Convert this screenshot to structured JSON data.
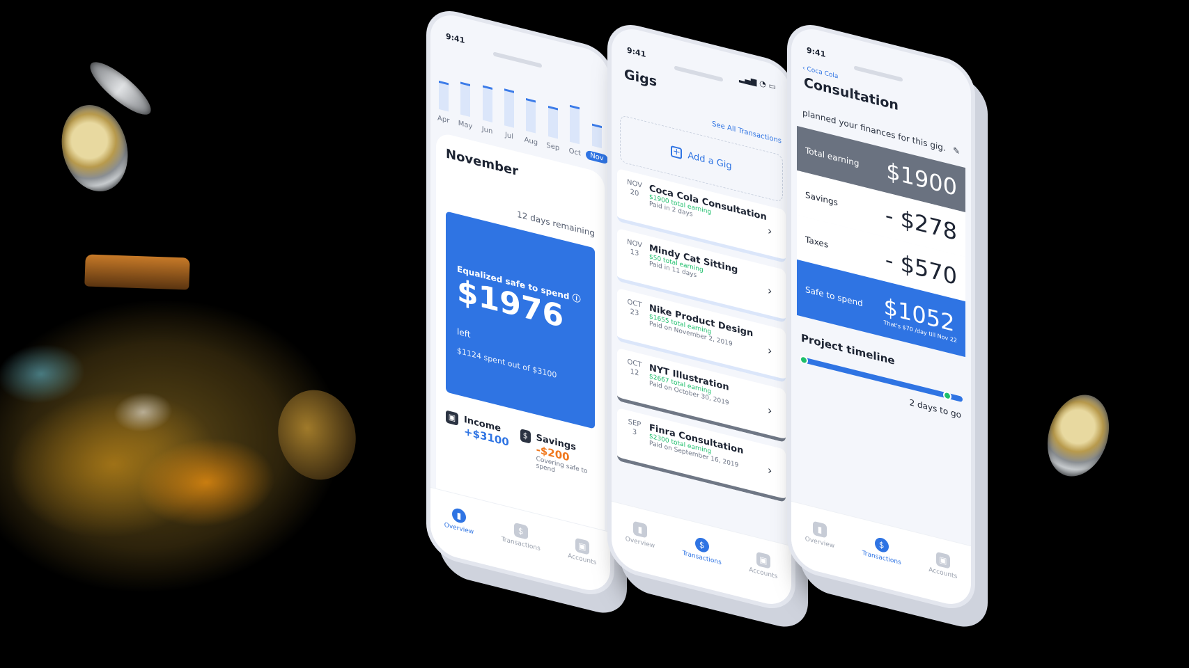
{
  "phone1": {
    "status_time": "9:41",
    "months": [
      {
        "label": "Apr",
        "fill": 0.35,
        "active": false
      },
      {
        "label": "May",
        "fill": 0.45,
        "active": false
      },
      {
        "label": "Jun",
        "fill": 0.5,
        "active": false
      },
      {
        "label": "Jul",
        "fill": 0.55,
        "active": false
      },
      {
        "label": "Aug",
        "fill": 0.45,
        "active": false
      },
      {
        "label": "Sep",
        "fill": 0.4,
        "active": false
      },
      {
        "label": "Oct",
        "fill": 0.55,
        "active": false
      },
      {
        "label": "Nov",
        "fill": 0.2,
        "active": true
      }
    ],
    "month_title": "November",
    "days_remaining": "12 days remaining",
    "safe_title": "Equalized safe to spend",
    "safe_amount": "$1976",
    "safe_suffix": "left",
    "spent_line": "$1124 spent out of $3100",
    "income_label": "Income",
    "income_value": "+$3100",
    "savings_label": "Savings",
    "savings_value": "-$200",
    "savings_note": "Covering safe to spend"
  },
  "phone2": {
    "status_time": "9:41",
    "title": "Gigs",
    "see_all": "See All Transactions",
    "add_gig": "Add a Gig",
    "gigs": [
      {
        "month": "NOV",
        "day": "20",
        "name": "Coca Cola Consultation",
        "earning": "$1900 total earning",
        "paid": "Paid in 2 days",
        "style": "light"
      },
      {
        "month": "NOV",
        "day": "13",
        "name": "Mindy Cat Sitting",
        "earning": "$50 total earning",
        "paid": "Paid in 11 days",
        "style": "light"
      },
      {
        "month": "OCT",
        "day": "23",
        "name": "Nike Product Design",
        "earning": "$1655 total earning",
        "paid": "Paid on November 2, 2019",
        "style": "light"
      },
      {
        "month": "OCT",
        "day": "12",
        "name": "NYT Illustration",
        "earning": "$2667 total earning",
        "paid": "Paid on October 30, 2019",
        "style": "dark"
      },
      {
        "month": "SEP",
        "day": "3",
        "name": "Finra Consultation",
        "earning": "$2300 total earning",
        "paid": "Paid on September 16, 2019",
        "style": "dark"
      }
    ]
  },
  "phone3": {
    "status_time": "9:41",
    "back_label": "Coca Cola",
    "title": "Consultation",
    "planned_text": "planned your finances for this gig.",
    "rows": {
      "total_label": "Total earning",
      "total_amount": "$1900",
      "savings_label": "Savings",
      "savings_amount": "- $278",
      "taxes_label": "Taxes",
      "taxes_amount": "- $570",
      "safe_label": "Safe to spend",
      "safe_amount": "$1052",
      "safe_note": "That's $70 /day till Nov 22"
    },
    "timeline_title": "Project timeline",
    "timeline_progress": 0.88,
    "days_to_go": "2 days to go"
  },
  "tabs": {
    "overview": "Overview",
    "transactions": "Transactions",
    "accounts": "Accounts"
  },
  "colors": {
    "accent": "#2f74e3",
    "positive": "#1ebf6b",
    "negative": "#f0781e",
    "dark_card": "#6a7280"
  }
}
